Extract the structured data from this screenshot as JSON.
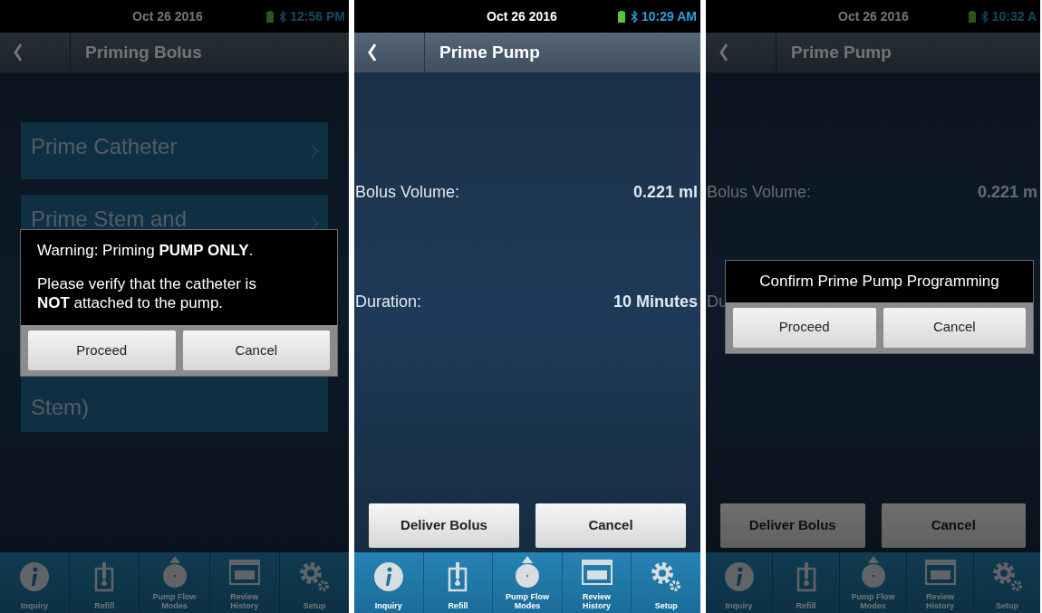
{
  "screens": [
    {
      "dimmed": true,
      "status_bar": {
        "date": "Oct 26 2016",
        "time": "12:56 PM"
      },
      "header": {
        "title": "Priming Bolus"
      },
      "body": {
        "kind": "menu",
        "items": [
          {
            "lines": [
              "Prime Catheter"
            ]
          },
          {
            "lines": [
              "Prime Stem and",
              "Stem)"
            ]
          }
        ]
      },
      "dialog": {
        "kind": "warning",
        "paragraphs": [
          [
            "Warning: Priming **PUMP ONLY**."
          ],
          [
            "Please verify that the catheter is",
            "**NOT** attached to the pump."
          ]
        ],
        "buttons": [
          "Proceed",
          "Cancel"
        ]
      },
      "nav": [
        {
          "kind": "info",
          "label": "Inquiry"
        },
        {
          "kind": "refill",
          "label": "Refill"
        },
        {
          "kind": "pump",
          "label": "Pump Flow Modes"
        },
        {
          "kind": "history",
          "label": "Review History"
        },
        {
          "kind": "gears",
          "label": "Setup"
        }
      ]
    },
    {
      "dimmed": false,
      "status_bar": {
        "date": "Oct 26 2016",
        "time": "10:29 AM"
      },
      "header": {
        "title": "Prime Pump"
      },
      "body": {
        "kind": "fields",
        "rows": [
          {
            "label": "Bolus Volume:",
            "value": "0.221 ml"
          },
          {
            "label": "Duration:",
            "value": "10 Minutes"
          }
        ],
        "actions": [
          "Deliver Bolus",
          "Cancel"
        ]
      },
      "nav": [
        {
          "kind": "info",
          "label": "Inquiry"
        },
        {
          "kind": "refill",
          "label": "Refill"
        },
        {
          "kind": "pump",
          "label": "Pump Flow Modes"
        },
        {
          "kind": "history",
          "label": "Review History"
        },
        {
          "kind": "gears",
          "label": "Setup"
        }
      ]
    },
    {
      "dimmed": true,
      "status_bar": {
        "date": "Oct 26 2016",
        "time": "10:32 A"
      },
      "header": {
        "title": "Prime Pump"
      },
      "body": {
        "kind": "fields",
        "rows": [
          {
            "label": "Bolus Volume:",
            "value": "0.221 m"
          },
          {
            "label": "Du"
          }
        ],
        "actions": [
          "Deliver Bolus",
          "Cancel"
        ]
      },
      "dialog": {
        "kind": "confirm",
        "title": "Confirm Prime Pump Programming",
        "buttons": [
          "Proceed",
          "Cancel"
        ]
      },
      "nav": [
        {
          "kind": "info",
          "label": "Inquiry"
        },
        {
          "kind": "refill",
          "label": "Refill"
        },
        {
          "kind": "pump",
          "label": "Pump Flow Modes"
        },
        {
          "kind": "history",
          "label": "Review History"
        },
        {
          "kind": "gears",
          "label": "Setup"
        }
      ]
    }
  ]
}
